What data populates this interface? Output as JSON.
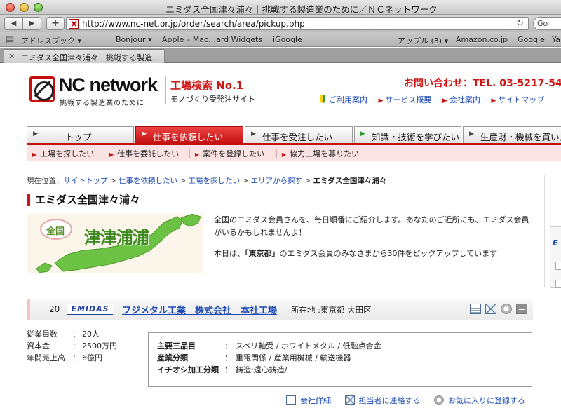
{
  "browser": {
    "window_title": "エミダス全国津々浦々｜挑戦する製造業のために／ＮＣネットワーク",
    "url": "http://www.nc-net.or.jp/order/search/area/pickup.php",
    "search_placeholder": "Go",
    "bookmarks": [
      "アドレスブック ▾",
      "Bonjour ▾",
      "Apple – Mac…ard Widgets",
      "iGoogle",
      "アップル (3) ▾",
      "Amazon.co.jp",
      "Google",
      "Yahoo"
    ],
    "tab_label": "エミダス全国津々浦々｜挑戦する製造..."
  },
  "header": {
    "logo_name": "NC network",
    "logo_tagline": "挑戦する製造業のために",
    "tagline_main": "工場検索 No.1",
    "tagline_sub": "モノづくり受発注サイト",
    "contact": "お問い合わせ：TEL. 03-5217-54",
    "util_links": [
      "ご利用案内",
      "サービス概要",
      "会社案内",
      "サイトマップ"
    ]
  },
  "nav": {
    "tabs": [
      "トップ",
      "仕事を依頼したい",
      "仕事を受注したい",
      "知識・技術を学びたい",
      "生産財・機械を買いたい"
    ],
    "subtabs": [
      "工場を探したい",
      "仕事を委託したい",
      "案件を登録したい",
      "協力工場を募りたい"
    ]
  },
  "breadcrumb": {
    "prefix": "現在位置：",
    "items": [
      "サイトトップ",
      "仕事を依頼したい",
      "工場を探したい",
      "エリアから探す"
    ],
    "separator": " > ",
    "current": "エミダス全国津々浦々"
  },
  "page": {
    "title": "エミダス全国津々浦々",
    "banner_zenkoku": "全国",
    "banner_title": "津津浦浦",
    "intro1": "全国のエミダス会員さんを、毎日順番にご紹介します。あなたのご近所にも、エミダス会員がいるかもしれませんよ！",
    "intro2_pre": "本日は、",
    "intro2_pref": "「東京都」",
    "intro2_post": "のエミダス会員のみなさまから30件をピックアップしています"
  },
  "side": {
    "logo": "E"
  },
  "company": {
    "rank": "20",
    "badge": "EMIDAS",
    "name": "フジメタル工業　株式会社　本社工場",
    "location": "所在地 :東京都 大田区",
    "stats": [
      {
        "label": "従業員数",
        "value": "20人"
      },
      {
        "label": "資本金",
        "value": "2500万円"
      },
      {
        "label": "年間売上高",
        "value": "6億円"
      }
    ],
    "details": [
      {
        "label": "主要三品目",
        "value": "スベリ軸受 / ホワイトメタル / 低融点合金"
      },
      {
        "label": "産業分類",
        "value": "重電関係 / 産業用機械 / 輸送機器"
      },
      {
        "label": "イチオシ加工分類",
        "value": "鋳造:遠心鋳造/"
      }
    ],
    "colon": "：",
    "actions": [
      "会社詳細",
      "担当者に連絡する",
      "お気に入りに登録する"
    ]
  },
  "colors": {
    "accent_red": "#d01414",
    "link_blue": "#1b49b3",
    "subnav_pink": "#fbe3e3"
  }
}
